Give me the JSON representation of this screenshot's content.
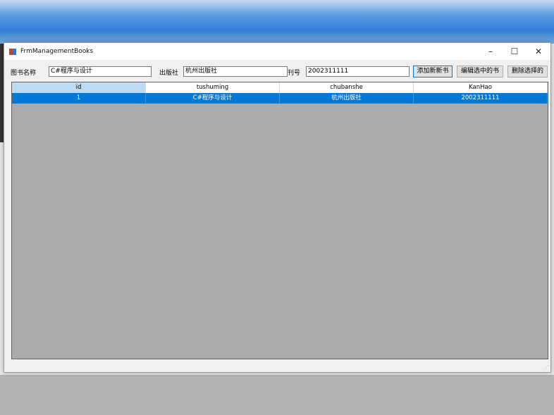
{
  "window": {
    "title": "FrmManagementBooks",
    "minimize": "–",
    "maximize": "☐",
    "close": "✕"
  },
  "form": {
    "book_name_label": "图书名称",
    "book_name_value": "C#程序与设计",
    "publisher_label": "出版社",
    "publisher_value": "杭州出版社",
    "issue_label": "刊号",
    "issue_value": "2002311111"
  },
  "buttons": {
    "add": "添加新新书",
    "edit": "编辑选中的书",
    "delete": "删除选择的"
  },
  "table": {
    "columns": [
      "id",
      "tushuming",
      "chubanshe",
      "KanHao"
    ],
    "rows": [
      [
        "1",
        "C#程序与设计",
        "杭州出版社",
        "2002311111"
      ]
    ]
  }
}
